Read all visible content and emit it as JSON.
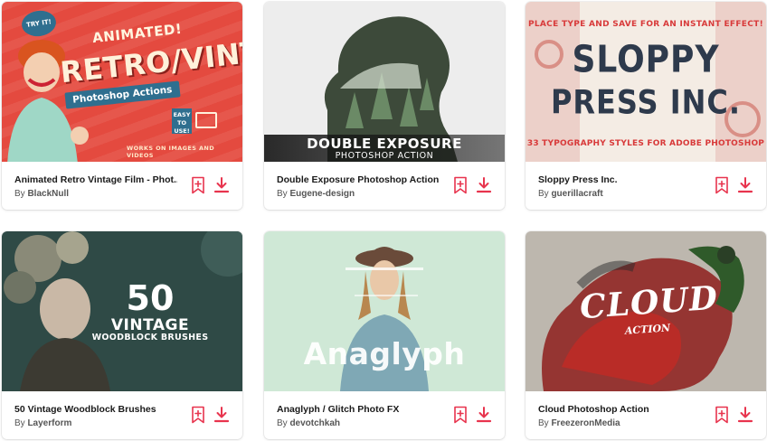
{
  "colors": {
    "accent": "#e8344e",
    "card_bg": "#ffffff",
    "title": "#1a1a1a",
    "author": "#555555"
  },
  "icons": {
    "bookmark": "bookmark-plus-icon",
    "download": "download-icon"
  },
  "items": [
    {
      "title": "Animated Retro Vintage Film - Phot...",
      "author_prefix": "By",
      "author": "BlackNull",
      "thumb": {
        "badge": "TRY IT!",
        "heading_small": "ANIMATED!",
        "heading_big": "RETRO/VINTAGE",
        "pill": "Photoshop Actions",
        "easy": "EASY TO USE!",
        "footer": "WORKS ON IMAGES AND VIDEOS"
      }
    },
    {
      "title": "Double Exposure Photoshop Action",
      "author_prefix": "By",
      "author": "Eugene-design",
      "thumb": {
        "heading": "DOUBLE EXPOSURE",
        "subheading": "PHOTOSHOP ACTION"
      }
    },
    {
      "title": "Sloppy Press Inc.",
      "author_prefix": "By",
      "author": "guerillacraft",
      "thumb": {
        "tagline": "PLACE TYPE AND SAVE FOR AN INSTANT EFFECT!",
        "line1": "SLOPPY",
        "line2": "PRESS INC.",
        "footer": "33 TYPOGRAPHY STYLES FOR ADOBE PHOTOSHOP"
      }
    },
    {
      "title": "50 Vintage Woodblock Brushes",
      "author_prefix": "By",
      "author": "Layerform",
      "thumb": {
        "number": "50",
        "word": "VINTAGE",
        "sub": "WOODBLOCK BRUSHES"
      }
    },
    {
      "title": "Anaglyph / Glitch Photo FX",
      "author_prefix": "By",
      "author": "devotchkah",
      "thumb": {
        "word": "Anaglyph"
      }
    },
    {
      "title": "Cloud Photoshop Action",
      "author_prefix": "By",
      "author": "FreezeronMedia",
      "thumb": {
        "word": "CLOUD",
        "sub": "ACTION"
      }
    }
  ]
}
